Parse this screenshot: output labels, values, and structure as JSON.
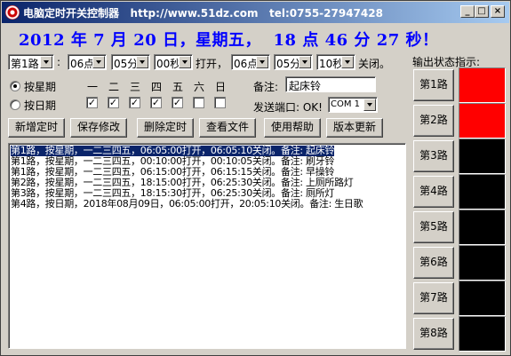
{
  "window": {
    "title": "电脑定时开关控制器   http://www.51dz.com   tel:0755-27947428"
  },
  "datetime": "2012 年 7 月 20 日，星期五，  18 点 46 分 27 秒！",
  "schedule": {
    "channel": "第1路",
    "colon": ":",
    "on_hour": "06点",
    "on_min": "05分",
    "on_sec": "00秒",
    "on_label": "打开，",
    "off_hour": "06点",
    "off_min": "05分",
    "off_sec": "10秒",
    "off_label": "关闭。"
  },
  "mode": {
    "weekly_label": "按星期",
    "daily_label": "按日期"
  },
  "weekdays": {
    "labels": [
      "一",
      "二",
      "三",
      "四",
      "五",
      "六",
      "日"
    ],
    "checked": [
      true,
      true,
      true,
      true,
      true,
      false,
      false
    ]
  },
  "note": {
    "label": "备注:",
    "value": "起床铃"
  },
  "port": {
    "label": "发送端口: OK!",
    "value": "COM 1"
  },
  "buttons": {
    "add": "新增定时",
    "save": "保存修改",
    "delete": "删除定时",
    "view": "查看文件",
    "help": "使用帮助",
    "update": "版本更新"
  },
  "list": {
    "items": [
      "第1路，按星期，一二三四五，06:05:00打开，06:05:10关闭。备注: 起床铃",
      "第1路，按星期，一二三四五，00:10:00打开，00:10:05关闭。备注: 刷牙铃",
      "第1路，按星期，一二三四五，06:15:00打开，06:15:15关闭。备注: 早操铃",
      "第2路，按星期，一二三四五，18:15:00打开，06:25:30关闭。备注: 上厕所路灯",
      "第3路，按星期，一二三四五，18:15:30打开，06:25:30关闭。备注: 厕所灯",
      "第4路，按日期，2018年08月09日，06:05:00打开，20:05:10关闭。备注: 生日歌"
    ],
    "selected_index": 0
  },
  "output": {
    "title": "输出状态指示:",
    "channels": [
      {
        "label": "第1路",
        "color": "#ff0000"
      },
      {
        "label": "第2路",
        "color": "#ff0000"
      },
      {
        "label": "第3路",
        "color": "#000000"
      },
      {
        "label": "第4路",
        "color": "#000000"
      },
      {
        "label": "第5路",
        "color": "#000000"
      },
      {
        "label": "第6路",
        "color": "#000000"
      },
      {
        "label": "第7路",
        "color": "#000000"
      },
      {
        "label": "第8路",
        "color": "#000000"
      }
    ]
  }
}
